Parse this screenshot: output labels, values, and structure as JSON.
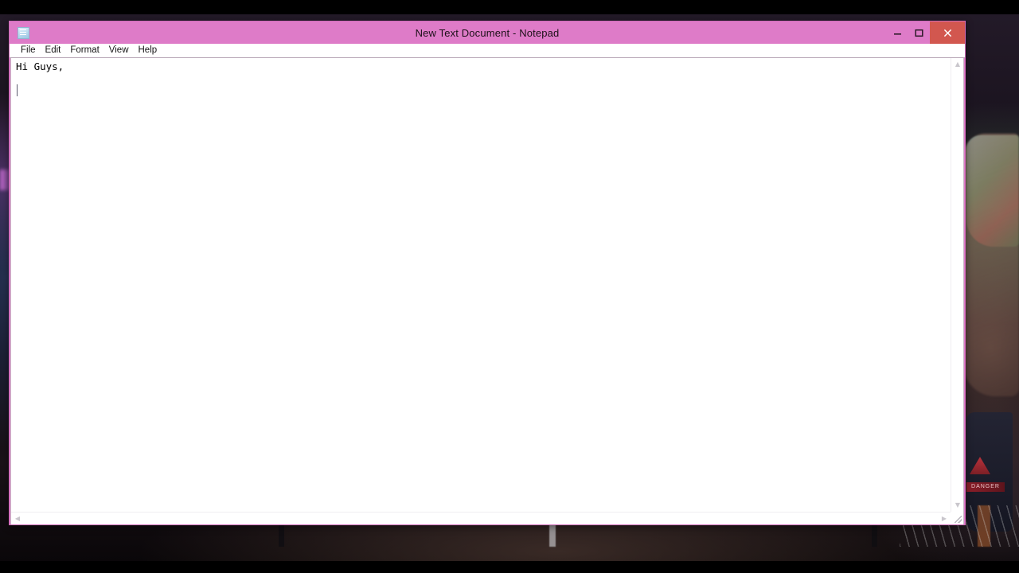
{
  "window": {
    "title": "New Text Document - Notepad",
    "app_icon": "notepad-document-icon",
    "titlebar_color": "#de7bc8",
    "border_color": "#e07cc9",
    "controls": {
      "minimize_label": "Minimize",
      "maximize_label": "Maximize",
      "close_label": "Close",
      "close_color": "#d2574f"
    }
  },
  "menubar": {
    "items": [
      {
        "label": "File"
      },
      {
        "label": "Edit"
      },
      {
        "label": "Format"
      },
      {
        "label": "View"
      },
      {
        "label": "Help"
      }
    ]
  },
  "document": {
    "lines": [
      "Hi Guys,",
      "",
      ""
    ],
    "caret_line": 3,
    "caret_column": 1
  },
  "scrollbars": {
    "vertical": {
      "up_arrow": "chevron-up-icon",
      "down_arrow": "chevron-down-icon"
    },
    "horizontal": {
      "left_arrow": "chevron-left-icon",
      "right_arrow": "chevron-right-icon"
    },
    "resize_grip": "resize-grip-icon"
  },
  "backdrop": {
    "danger_label": "DANGER"
  }
}
